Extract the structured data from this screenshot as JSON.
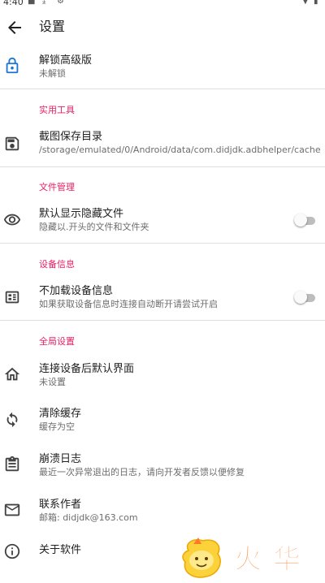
{
  "status_bar": {
    "time": "4:40"
  },
  "app_bar": {
    "title": "设置"
  },
  "unlock": {
    "title": "解锁高级版",
    "subtitle": "未解锁"
  },
  "sections": {
    "tools": "实用工具",
    "files": "文件管理",
    "device": "设备信息",
    "global": "全局设置"
  },
  "screenshot_dir": {
    "title": "截图保存目录",
    "subtitle": "/storage/emulated/0/Android/data/com.didjdk.adbhelper/cache"
  },
  "show_hidden": {
    "title": "默认显示隐藏文件",
    "subtitle": "隐藏以.开头的文件和文件夹",
    "enabled": false
  },
  "no_device_info": {
    "title": "不加载设备信息",
    "subtitle": "如果获取设备信息时连接自动断开请尝试开启",
    "enabled": false
  },
  "default_page": {
    "title": "连接设备后默认界面",
    "subtitle": "未设置"
  },
  "clear_cache": {
    "title": "清除缓存",
    "subtitle": "缓存为空"
  },
  "crash_log": {
    "title": "崩溃日志",
    "subtitle": "最近一次异常退出的日志，请向开发者反馈以便修复"
  },
  "contact": {
    "title": "联系作者",
    "subtitle": "邮箱: didjdk@163.com"
  },
  "about": {
    "title": "关于软件"
  },
  "watermark": {
    "text": "火华"
  },
  "icons": [
    "back-arrow-icon",
    "lock-icon",
    "save-icon",
    "eye-icon",
    "device-info-icon",
    "home-icon",
    "sync-icon",
    "clipboard-icon",
    "mail-icon",
    "info-icon"
  ],
  "colors": {
    "accent": "#e91e63",
    "lock_blue": "#1976d2",
    "divider": "#e0e0e0",
    "switch_off": "#bdbdbd"
  }
}
